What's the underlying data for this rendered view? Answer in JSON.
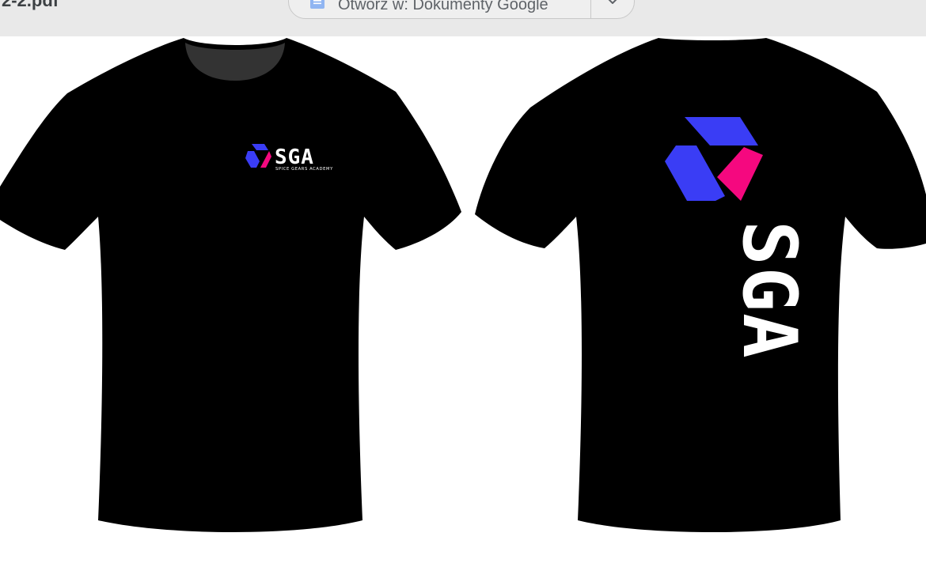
{
  "viewer": {
    "file_name": "2-2.pdf",
    "open_with_label": "Otwórz w: Dokumenty Google",
    "open_with_icon": "docs-icon",
    "dropdown_icon": "chevron-down-icon"
  },
  "design": {
    "front": {
      "logo_wordmark": "SGA",
      "logo_tagline": "SPICE GEARS ACADEMY"
    },
    "back": {
      "logo_wordmark": "SGA"
    },
    "colors": {
      "shirt": "#000000",
      "logo_blue": "#3a3df5",
      "logo_pink": "#f5087f",
      "wordmark": "#ffffff",
      "collar": "#333333"
    }
  }
}
